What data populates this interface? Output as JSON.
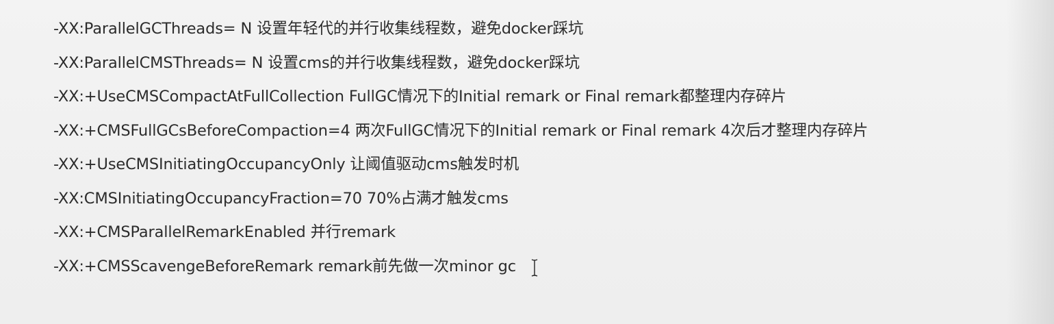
{
  "lines": [
    "-XX:ParallelGCThreads= N 设置年轻代的并行收集线程数，避免docker踩坑",
    "-XX:ParallelCMSThreads= N 设置cms的并行收集线程数，避免docker踩坑",
    "-XX:+UseCMSCompactAtFullCollection FullGC情况下的Initial remark or Final remark都整理内存碎片",
    "-XX:+CMSFullGCsBeforeCompaction=4 两次FullGC情况下的Initial remark or Final remark 4次后才整理内存碎片",
    "-XX:+UseCMSInitiatingOccupancyOnly 让阈值驱动cms触发时机",
    "-XX:CMSInitiatingOccupancyFraction=70 70%占满才触发cms",
    "-XX:+CMSParallelRemarkEnabled 并行remark",
    "-XX:+CMSScavengeBeforeRemark remark前先做一次minor gc"
  ]
}
